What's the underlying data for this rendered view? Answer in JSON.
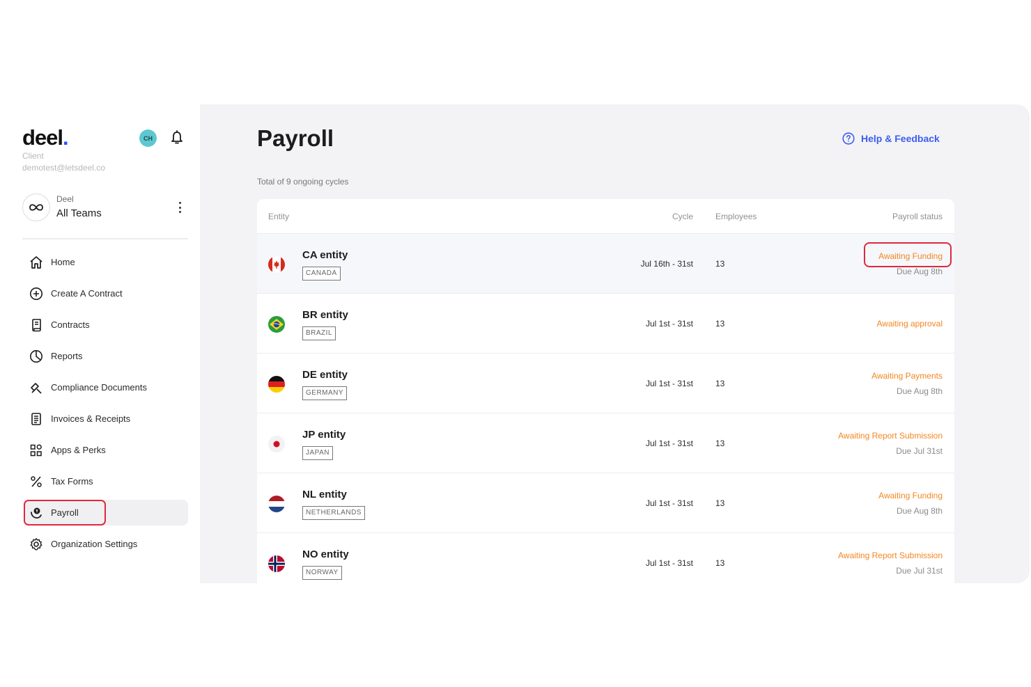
{
  "sidebar": {
    "logo": "deel",
    "logo_dot": ".",
    "role": "Client",
    "email": "demotest@letsdeel.co",
    "avatar_initials": "CH",
    "team": {
      "org": "Deel",
      "name": "All Teams"
    },
    "nav": [
      {
        "label": "Home",
        "icon": "home-icon"
      },
      {
        "label": "Create A Contract",
        "icon": "plus-circle-icon"
      },
      {
        "label": "Contracts",
        "icon": "contract-icon"
      },
      {
        "label": "Reports",
        "icon": "pie-chart-icon"
      },
      {
        "label": "Compliance Documents",
        "icon": "compliance-icon"
      },
      {
        "label": "Invoices & Receipts",
        "icon": "invoice-icon"
      },
      {
        "label": "Apps & Perks",
        "icon": "apps-grid-icon"
      },
      {
        "label": "Tax Forms",
        "icon": "percent-icon"
      },
      {
        "label": "Payroll",
        "icon": "payroll-icon",
        "active": true
      },
      {
        "label": "Organization Settings",
        "icon": "gear-icon"
      }
    ]
  },
  "main": {
    "title": "Payroll",
    "help": "Help & Feedback",
    "subtitle": "Total of 9 ongoing cycles",
    "columns": {
      "entity": "Entity",
      "cycle": "Cycle",
      "employees": "Employees",
      "status": "Payroll status"
    },
    "rows": [
      {
        "name": "CA entity",
        "country": "CANADA",
        "cycle": "Jul 16th - 31st",
        "employees": "13",
        "status": "Awaiting Funding",
        "due": "Due Aug 8th",
        "flag": "canada-flag-icon"
      },
      {
        "name": "BR entity",
        "country": "BRAZIL",
        "cycle": "Jul 1st - 31st",
        "employees": "13",
        "status": "Awaiting approval",
        "due": "",
        "flag": "brazil-flag-icon"
      },
      {
        "name": "DE entity",
        "country": "GERMANY",
        "cycle": "Jul 1st - 31st",
        "employees": "13",
        "status": "Awaiting Payments",
        "due": "Due Aug 8th",
        "flag": "germany-flag-icon"
      },
      {
        "name": "JP entity",
        "country": "JAPAN",
        "cycle": "Jul 1st - 31st",
        "employees": "13",
        "status": "Awaiting Report Submission",
        "due": "Due Jul 31st",
        "flag": "japan-flag-icon"
      },
      {
        "name": "NL entity",
        "country": "NETHERLANDS",
        "cycle": "Jul 1st - 31st",
        "employees": "13",
        "status": "Awaiting Funding",
        "due": "Due Aug 8th",
        "flag": "netherlands-flag-icon"
      },
      {
        "name": "NO entity",
        "country": "NORWAY",
        "cycle": "Jul 1st - 31st",
        "employees": "13",
        "status": "Awaiting Report Submission",
        "due": "Due Jul 31st",
        "flag": "norway-flag-icon"
      }
    ]
  },
  "colors": {
    "accent": "#3b5df2",
    "status": "#f3861f",
    "highlight": "#e0283c"
  }
}
